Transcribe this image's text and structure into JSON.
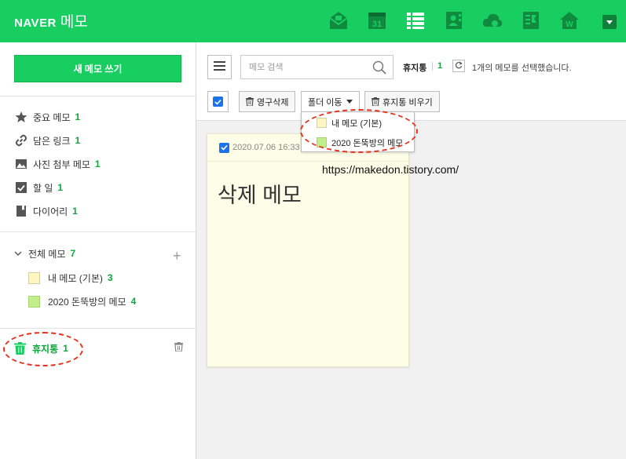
{
  "header": {
    "brand": "NAVER",
    "service": "메모",
    "icons": [
      "mail-icon",
      "calendar-icon",
      "memo-list-icon",
      "contacts-icon",
      "cloud-icon",
      "office-icon",
      "blog-home-icon"
    ],
    "calendar_day": "31",
    "accent": "#19ce60"
  },
  "sidebar": {
    "new_memo": "새 메모 쓰기",
    "quick": [
      {
        "label": "중요 메모",
        "count": "1",
        "icon": "star-icon"
      },
      {
        "label": "담은 링크",
        "count": "1",
        "icon": "link-icon"
      },
      {
        "label": "사진 첨부 메모",
        "count": "1",
        "icon": "photo-icon"
      },
      {
        "label": "할 일",
        "count": "1",
        "icon": "checkbox-icon"
      },
      {
        "label": "다이어리",
        "count": "1",
        "icon": "diary-icon"
      }
    ],
    "all_memo": {
      "label": "전체 메모",
      "count": "7"
    },
    "folders": [
      {
        "label": "내 메모 (기본)",
        "count": "3",
        "color": "#fdf6c3"
      },
      {
        "label": "2020 돈뚝방의 메모",
        "count": "4",
        "color": "#c2ee8a"
      }
    ],
    "trash": {
      "label": "휴지통",
      "count": "1"
    }
  },
  "toolbar": {
    "search_placeholder": "메모 검색",
    "current_folder": "휴지통",
    "current_count": "1",
    "selection_message": "1개의 메모를 선택했습니다.",
    "delete_forever": "영구삭제",
    "move_folder": "폴더 이동",
    "empty_trash": "휴지통 비우기"
  },
  "dropdown": {
    "items": [
      {
        "label": "내 메모 (기본)",
        "color": "#fdf6c3"
      },
      {
        "label": "2020 돈뚝방의 메모",
        "color": "#c2ee8a"
      }
    ]
  },
  "memo": {
    "date": "2020.07.06 16:33",
    "title": "삭제 메모"
  },
  "watermark_url": "https://makedon.tistory.com/"
}
